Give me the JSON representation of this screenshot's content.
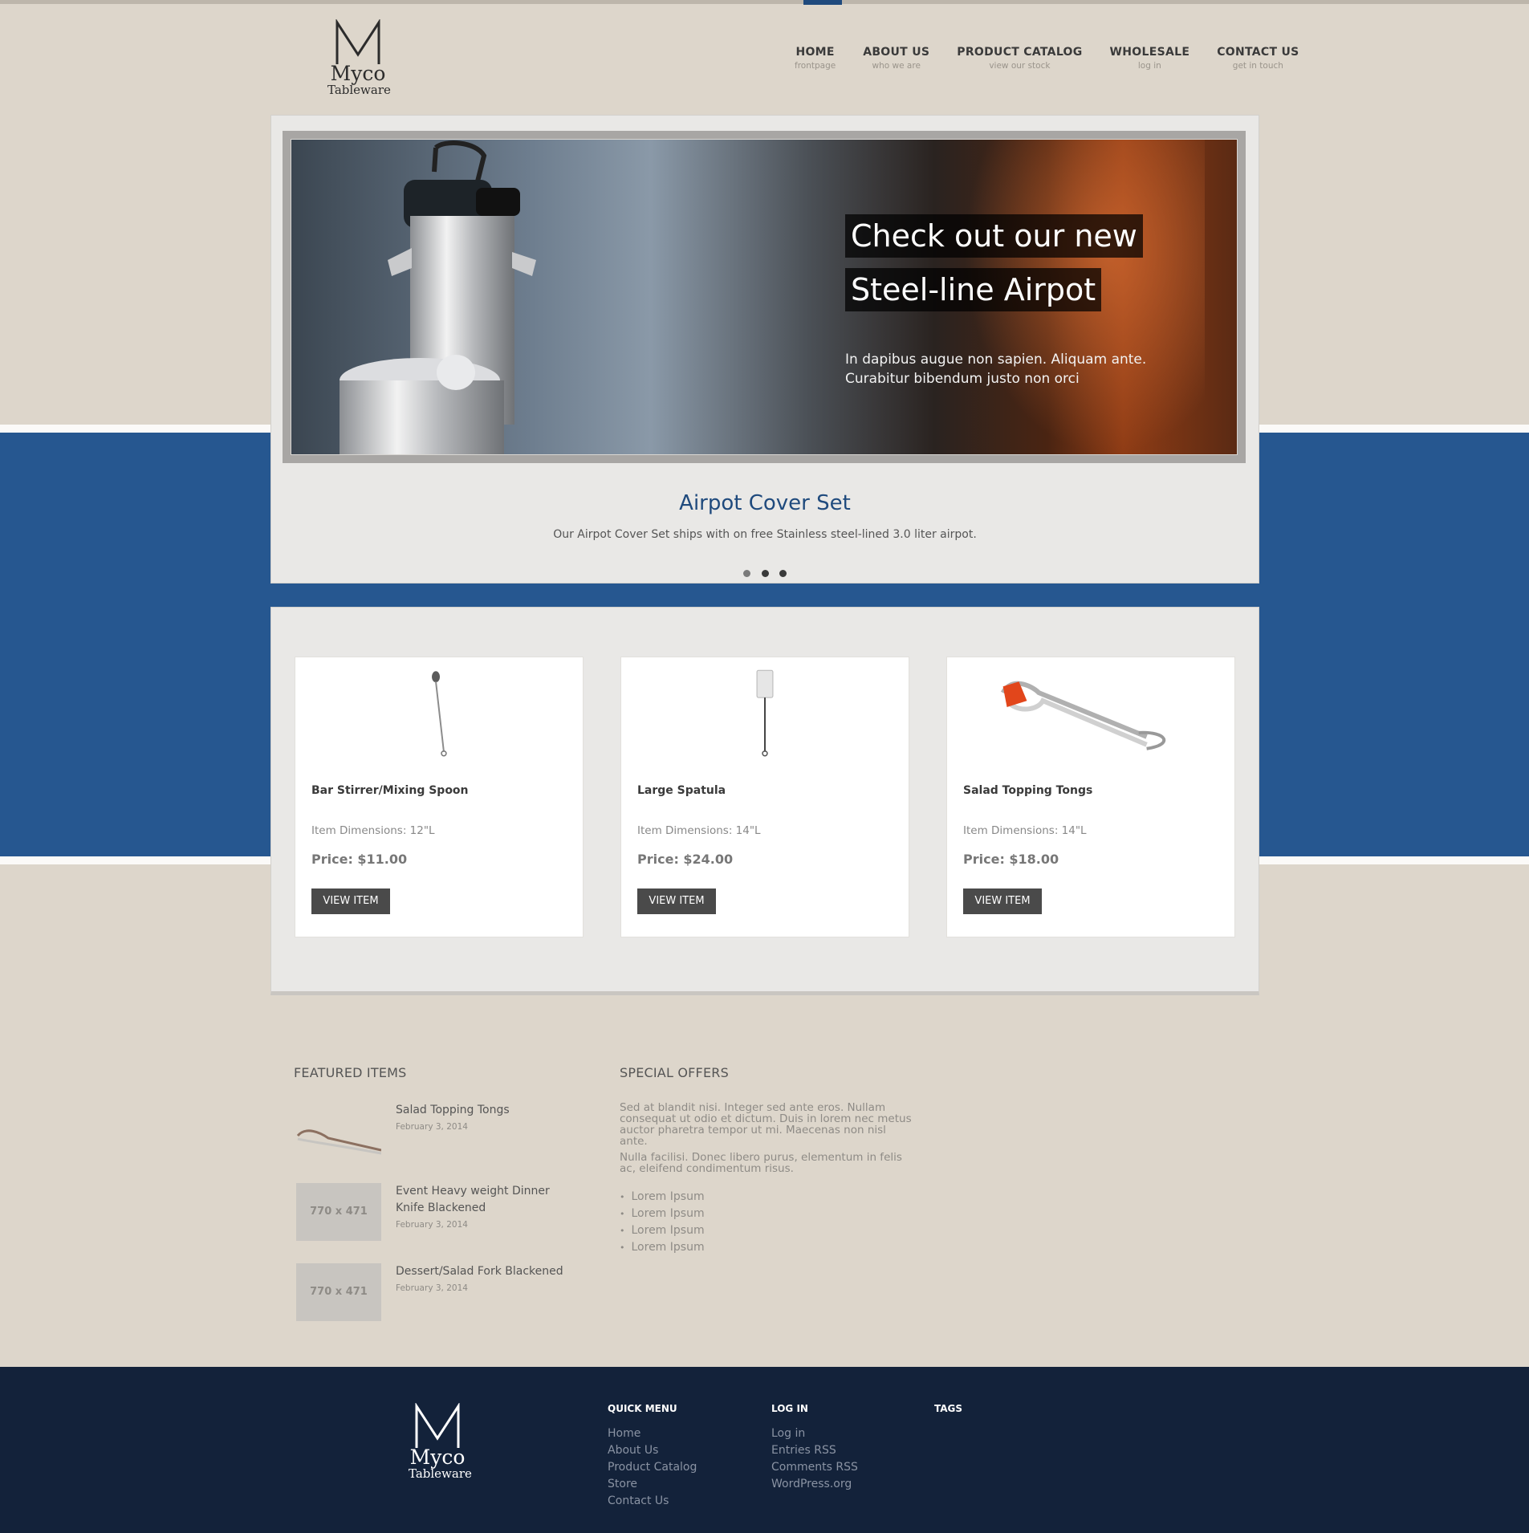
{
  "brand": {
    "name": "Myco",
    "sub": "Tableware"
  },
  "nav": [
    {
      "title": "HOME",
      "sub": "frontpage"
    },
    {
      "title": "ABOUT US",
      "sub": "who we are"
    },
    {
      "title": "PRODUCT CATALOG",
      "sub": "view our stock"
    },
    {
      "title": "WHOLESALE",
      "sub": "log in"
    },
    {
      "title": "CONTACT US",
      "sub": "get in touch"
    }
  ],
  "slider": {
    "caption_line1": "Check out our new",
    "caption_line2": "Steel-line Airpot",
    "caption_sub": "In dapibus augue non sapien. Aliquam ante. Curabitur bibendum justo non orci",
    "title": "Airpot Cover Set",
    "description": "Our Airpot Cover Set ships with on free Stainless steel-lined 3.0 liter airpot.",
    "slide_count": 3,
    "active_slide": 1
  },
  "products": [
    {
      "name": "Bar Stirrer/Mixing Spoon",
      "dims": "Item Dimensions: 12\"L",
      "price": "Price: $11.00",
      "button": "VIEW ITEM",
      "icon": "spoon-icon"
    },
    {
      "name": "Large Spatula",
      "dims": "Item Dimensions: 14\"L",
      "price": "Price: $24.00",
      "button": "VIEW ITEM",
      "icon": "spatula-icon"
    },
    {
      "name": "Salad Topping Tongs",
      "dims": "Item Dimensions: 14\"L",
      "price": "Price: $18.00",
      "button": "VIEW ITEM",
      "icon": "tongs-icon"
    }
  ],
  "featured": {
    "heading": "FEATURED ITEMS",
    "items": [
      {
        "title": "Salad Topping Tongs",
        "date": "February 3, 2014",
        "thumb": ""
      },
      {
        "title": "Event Heavy weight Dinner Knife Blackened",
        "date": "February 3, 2014",
        "thumb": "770 x 471"
      },
      {
        "title": "Dessert/Salad Fork Blackened",
        "date": "February 3, 2014",
        "thumb": "770 x 471"
      }
    ]
  },
  "offers": {
    "heading": "SPECIAL OFFERS",
    "para1": "Sed at blandit nisi. Integer sed ante eros. Nullam consequat ut odio et dictum. Duis in lorem nec metus auctor pharetra tempor ut mi. Maecenas non nisl ante.",
    "para2": "Nulla facilisi. Donec libero purus, elementum in felis ac, eleifend condimentum risus.",
    "list": [
      "Lorem Ipsum",
      "Lorem Ipsum",
      "Lorem Ipsum",
      "Lorem Ipsum"
    ]
  },
  "footer": {
    "quick_menu": {
      "heading": "QUICK MENU",
      "links": [
        "Home",
        "About Us",
        "Product Catalog",
        "Store",
        "Contact Us"
      ]
    },
    "login": {
      "heading": "LOG IN",
      "links": [
        "Log in",
        "Entries RSS",
        "Comments RSS",
        "WordPress.org"
      ]
    },
    "tags": {
      "heading": "TAGS"
    }
  },
  "colors": {
    "brand_blue": "#265790",
    "footer": "#13223a",
    "title_blue": "#1f4a7d"
  }
}
